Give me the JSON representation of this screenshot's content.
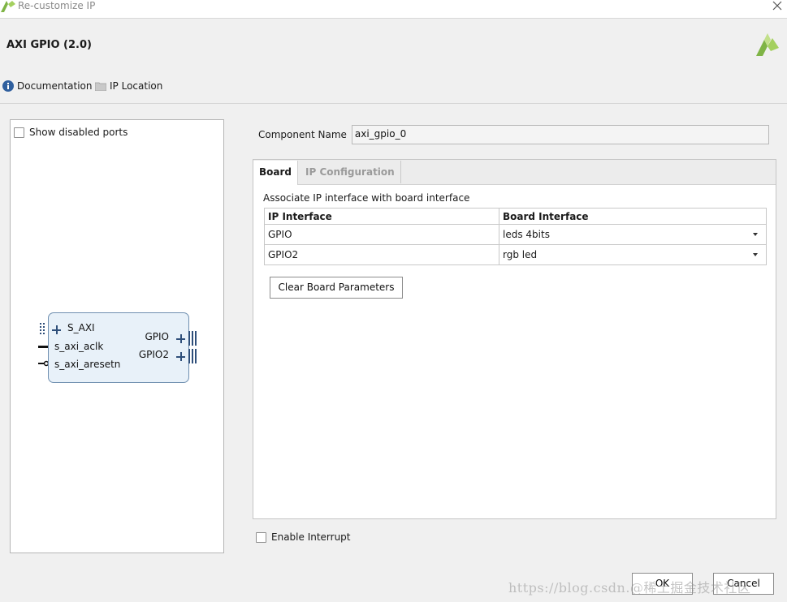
{
  "window": {
    "title": "Re-customize IP",
    "close_icon": "close-icon"
  },
  "header": {
    "ip_name": "AXI GPIO (2.0)",
    "documentation_label": "Documentation",
    "ip_location_label": "IP Location"
  },
  "left_panel": {
    "show_disabled_ports_label": "Show disabled ports",
    "symbol": {
      "left_ports": [
        "S_AXI",
        "s_axi_aclk",
        "s_axi_aresetn"
      ],
      "right_ports": [
        "GPIO",
        "GPIO2"
      ]
    }
  },
  "component": {
    "label": "Component Name",
    "value": "axi_gpio_0"
  },
  "tabs": [
    {
      "label": "Board",
      "active": true
    },
    {
      "label": "IP Configuration",
      "active": false
    }
  ],
  "board_tab": {
    "description": "Associate IP interface with board interface",
    "columns": [
      "IP Interface",
      "Board Interface"
    ],
    "rows": [
      {
        "ip_interface": "GPIO",
        "board_interface": "leds 4bits"
      },
      {
        "ip_interface": "GPIO2",
        "board_interface": "rgb led"
      }
    ],
    "clear_button": "Clear Board Parameters"
  },
  "enable_interrupt_label": "Enable Interrupt",
  "footer": {
    "ok_label": "OK",
    "cancel_label": "Cancel"
  },
  "watermark": "https://blog.csdn.@稀土掘金技术社区",
  "colors": {
    "accent_green": "#8cc63f",
    "symbol_fill": "#e8f1f9",
    "symbol_border": "#6f8fb0",
    "info_icon": "#2f5f9e"
  }
}
